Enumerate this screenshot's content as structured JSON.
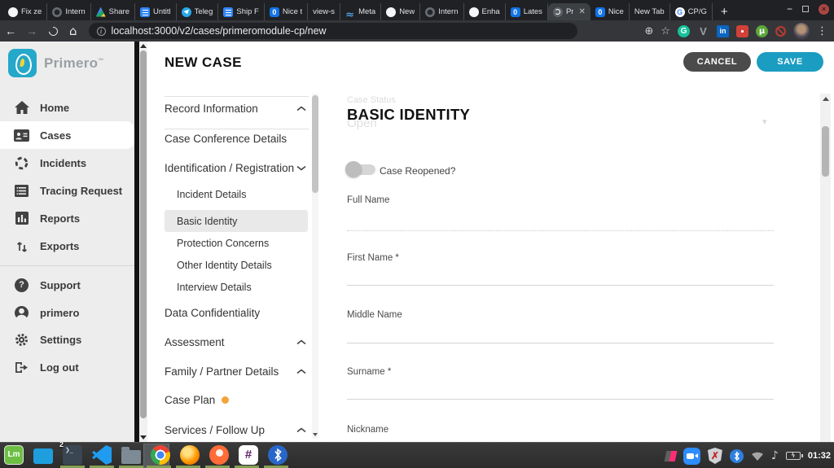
{
  "colors": {
    "brand_teal": "#25a8c9",
    "save_button": "#1b9dc1",
    "cancel_button": "#4b4b4b",
    "case_plan_dot": "#f2a33a",
    "selected_nav_bg": "#e9e9e9"
  },
  "browser": {
    "tabs": [
      {
        "label": "Fix ze",
        "icon": "github"
      },
      {
        "label": "Intern",
        "icon": "dark-app"
      },
      {
        "label": "Share",
        "icon": "google-drive"
      },
      {
        "label": "Untitl",
        "icon": "google-docs"
      },
      {
        "label": "Teleg",
        "icon": "telegram"
      },
      {
        "label": "Ship F",
        "icon": "google-docs"
      },
      {
        "label": "Nice t",
        "icon": "blue-app"
      },
      {
        "label": "view-s",
        "icon": "none"
      },
      {
        "label": "Meta",
        "icon": "metabase"
      },
      {
        "label": "New",
        "icon": "github"
      },
      {
        "label": "Intern",
        "icon": "dark-app"
      },
      {
        "label": "Enha",
        "icon": "github"
      },
      {
        "label": "Lates",
        "icon": "blue-app"
      },
      {
        "label": "Pr",
        "icon": "primero-favicon",
        "active": true
      },
      {
        "label": "Nice",
        "icon": "blue-app"
      },
      {
        "label": "New Tab",
        "icon": "none"
      },
      {
        "label": "CP/G",
        "icon": "google"
      }
    ],
    "new_tab_button": "+",
    "window_controls": {
      "minimize": "−",
      "close": "×"
    },
    "toolbar": {
      "url": "localhost:3000/v2/cases/primeromodule-cp/new",
      "back": "←",
      "forward": "→",
      "extension_v": "V",
      "extension_grammarly": "G",
      "extension_linkedin": "in",
      "extension_utorrent": "µ",
      "bookmark_star": "☆",
      "zoom_plus": "⊕",
      "menu_kebab": "⋮"
    }
  },
  "sidebar": {
    "brand": "Primero",
    "nav_main": [
      {
        "label": "Home"
      },
      {
        "label": "Cases",
        "selected": true
      },
      {
        "label": "Incidents"
      },
      {
        "label": "Tracing Request"
      },
      {
        "label": "Reports"
      },
      {
        "label": "Exports"
      }
    ],
    "nav_secondary": [
      {
        "label": "Support"
      },
      {
        "label": "primero"
      },
      {
        "label": "Settings"
      },
      {
        "label": "Log out"
      }
    ]
  },
  "header": {
    "title": "NEW CASE",
    "cancel_label": "CANCEL",
    "save_label": "SAVE"
  },
  "form_nav": {
    "items": [
      {
        "label": "Record Information",
        "chevron": "up"
      },
      {
        "label": "Case Conference Details"
      },
      {
        "label": "Identification / Registration",
        "chevron": "down"
      },
      {
        "label": "Incident Details",
        "sub": true
      },
      {
        "label": "Basic Identity",
        "sub": true,
        "selected": true
      },
      {
        "label": "Protection Concerns",
        "sub": true
      },
      {
        "label": "Other Identity Details",
        "sub": true
      },
      {
        "label": "Interview Details",
        "sub": true
      },
      {
        "label": "Data Confidentiality"
      },
      {
        "label": "Assessment",
        "chevron": "up"
      },
      {
        "label": "Family / Partner Details",
        "chevron": "up"
      },
      {
        "label": "Case Plan",
        "has_badge_dot": true
      },
      {
        "label": "Services / Follow Up",
        "chevron": "up"
      }
    ]
  },
  "form": {
    "section_title": "BASIC IDENTITY",
    "background_field_label": "Case Status",
    "background_field_value": "Open",
    "toggle_label": "Case Reopened?",
    "fields": [
      {
        "label": "Full Name",
        "value": ""
      },
      {
        "label": "First Name *",
        "value": ""
      },
      {
        "label": "Middle Name",
        "value": ""
      },
      {
        "label": "Surname *",
        "value": ""
      },
      {
        "label": "Nickname",
        "value": ""
      }
    ]
  },
  "taskbar": {
    "clock": "01:32",
    "terminal_badge": "2",
    "slack_glyph": "#",
    "mint_glyph": "Lm"
  }
}
